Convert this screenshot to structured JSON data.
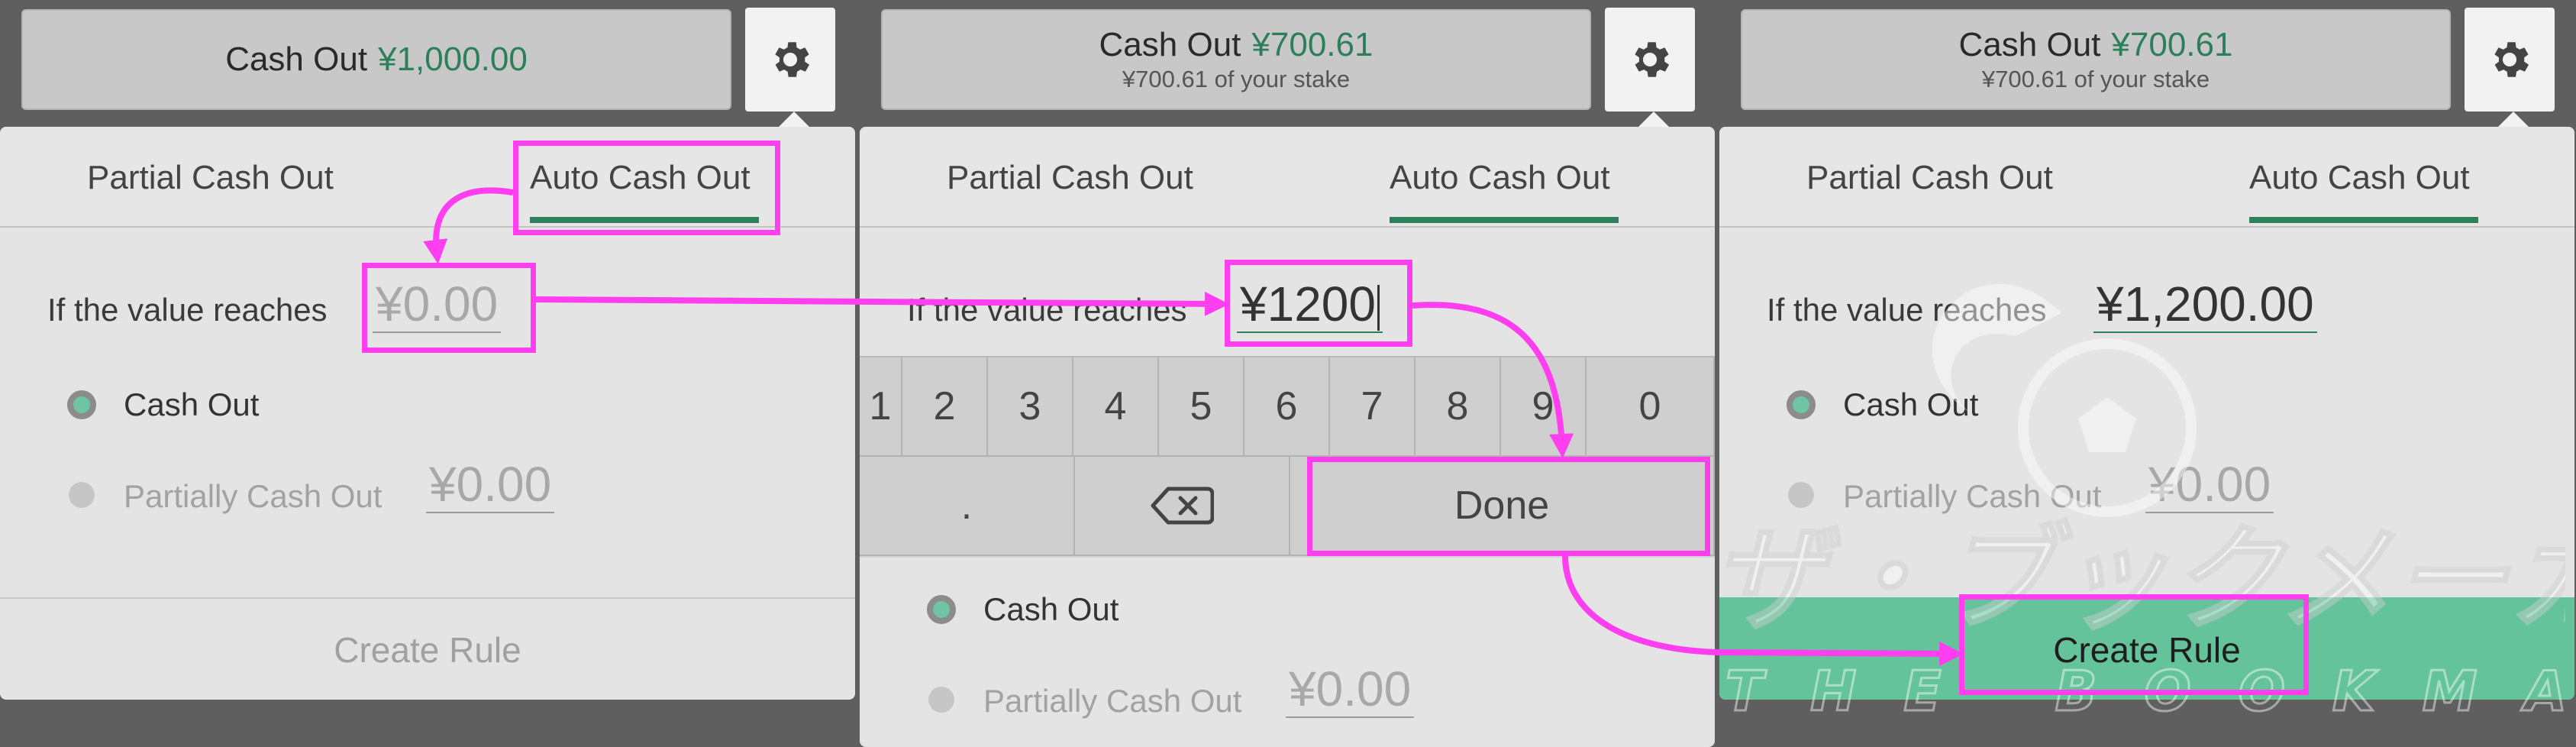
{
  "colors": {
    "accent": "#2f7f5c",
    "active_button": "#64c39b",
    "annotation": "#ff3ef0",
    "background": "#5f5f5f"
  },
  "panels": [
    {
      "cash_label": "Cash Out",
      "cash_amount": "¥1,000.00",
      "cash_sub": "",
      "tabs": {
        "partial": "Partial Cash Out",
        "auto": "Auto Cash Out"
      },
      "value_label": "If the value reaches",
      "value_input": "¥0.00",
      "option_cash_out": "Cash Out",
      "option_partial": "Partially Cash Out",
      "partial_value": "¥0.00",
      "create_rule": "Create Rule"
    },
    {
      "cash_label": "Cash Out",
      "cash_amount": "¥700.61",
      "cash_sub": "¥700.61 of your stake",
      "tabs": {
        "partial": "Partial Cash Out",
        "auto": "Auto Cash Out"
      },
      "value_label": "If the value reaches",
      "value_input": "¥1200",
      "keypad": {
        "digits": [
          "1",
          "2",
          "3",
          "4",
          "5",
          "6",
          "7",
          "8",
          "9",
          "0"
        ],
        "dot": ".",
        "backspace_icon": "backspace-icon",
        "done": "Done"
      },
      "option_cash_out": "Cash Out",
      "option_partial": "Partially Cash Out",
      "partial_value": "¥0.00"
    },
    {
      "cash_label": "Cash Out",
      "cash_amount": "¥700.61",
      "cash_sub": "¥700.61 of your stake",
      "tabs": {
        "partial": "Partial Cash Out",
        "auto": "Auto Cash Out"
      },
      "value_label": "If the value reaches",
      "value_input": "¥1,200.00",
      "option_cash_out": "Cash Out",
      "option_partial": "Partially Cash Out",
      "partial_value": "¥0.00",
      "create_rule": "Create Rule"
    }
  ],
  "watermark": {
    "jp": "ザ・ブックメーカーズ",
    "en": "THE BOOKMAKERS"
  }
}
